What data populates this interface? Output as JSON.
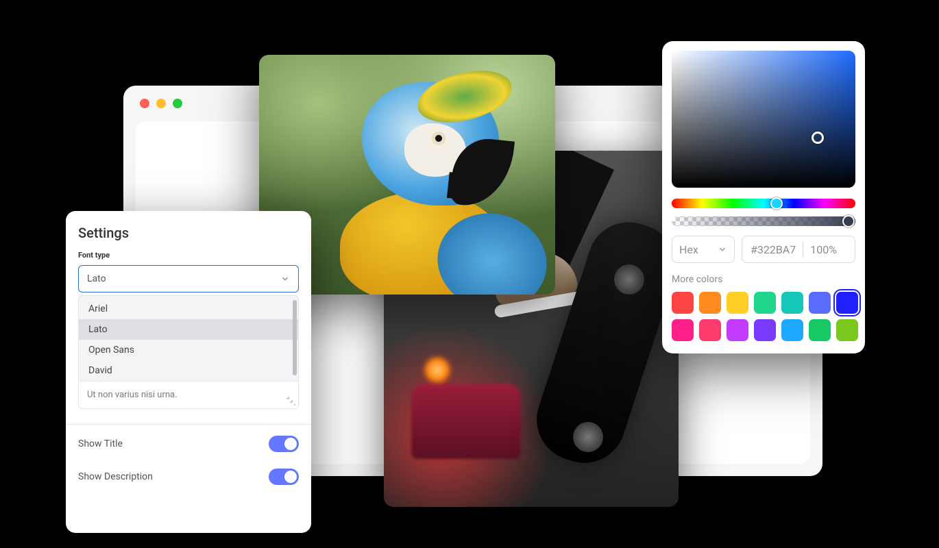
{
  "settings": {
    "title": "Settings",
    "font_type_label": "Font type",
    "font_type_selected": "Lato",
    "font_options": [
      "Ariel",
      "Lato",
      "Open Sans",
      "David"
    ],
    "font_options_selected_index": 1,
    "note_text": "Ut non varius nisi urna.",
    "toggles": {
      "show_title": {
        "label": "Show Title",
        "on": true
      },
      "show_description": {
        "label": "Show Description",
        "on": true
      }
    }
  },
  "color_picker": {
    "mode_label": "Hex",
    "hex_value": "#322BA7",
    "opacity_label": "100%",
    "more_label": "More colors",
    "swatches_row1": [
      "#ff4444",
      "#ff8a1f",
      "#ffcf26",
      "#1fd68a",
      "#15c7b8",
      "#5a6bff",
      "#2020ff"
    ],
    "swatches_row2": [
      "#ff1f8a",
      "#ff3b6b",
      "#c23bff",
      "#7a3bff",
      "#1fa8ff",
      "#17c964",
      "#7ac71f"
    ],
    "selected_swatch": "#2020ff"
  },
  "window": {
    "traffic_light_colors": [
      "#ff5f57",
      "#febc2e",
      "#28c840"
    ]
  }
}
